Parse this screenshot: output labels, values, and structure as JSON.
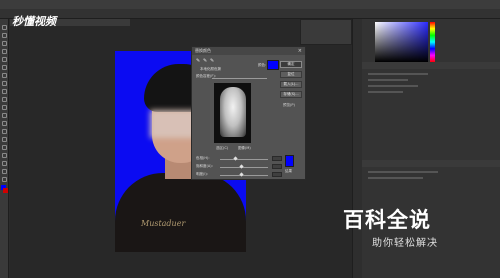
{
  "watermark": {
    "brand": "秒懂视频",
    "title": "百科全说",
    "subtitle": "助你轻松解决"
  },
  "dialog": {
    "title": "替换颜色",
    "selection_label": "本地化颜色簇",
    "color_label": "颜色:",
    "fuzziness_label": "颜色容差(F):",
    "radio_selection": "选区(C)",
    "radio_image": "图像(M)",
    "replace_header": "替换",
    "hue_label": "色相(H):",
    "saturation_label": "饱和度(A):",
    "lightness_label": "明度(I):",
    "result_label": "结果",
    "ok_label": "确定",
    "reset_label": "复位",
    "load_label": "载入(L)...",
    "save_label": "存储(S)...",
    "preview_label": "预览(P)",
    "hue_value": "",
    "saturation_value": "",
    "lightness_value": ""
  },
  "colors": {
    "background_blue": "#0b0bf2",
    "replace_color": "#0000ff"
  },
  "icons": [
    "eyedropper-icon",
    "eyedropper-plus-icon",
    "eyedropper-minus-icon",
    "close-icon"
  ]
}
